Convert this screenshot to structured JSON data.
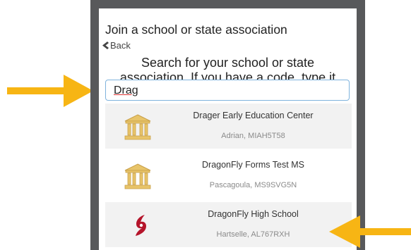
{
  "header": {
    "title": "Join a school or state association",
    "back_label": "Back"
  },
  "prompt": {
    "line1": "Search for your school or state",
    "line2": "association. If you have a code, type it"
  },
  "search": {
    "value": "Drag"
  },
  "results": [
    {
      "name": "Drager Early Education Center",
      "location": "Adrian, MIAH5T58",
      "icon": "school-building-icon"
    },
    {
      "name": "DragonFly Forms Test MS",
      "location": "Pascagoula, MS9SVG5N",
      "icon": "school-building-icon"
    },
    {
      "name": "DragonFly High School",
      "location": "Hartselle, AL767RXH",
      "icon": "hurricane-logo-icon"
    }
  ],
  "colors": {
    "arrow": "#f7b514",
    "logo_red": "#b5152b",
    "building_gold": "#e8c469",
    "input_border": "#7fb3dd"
  }
}
